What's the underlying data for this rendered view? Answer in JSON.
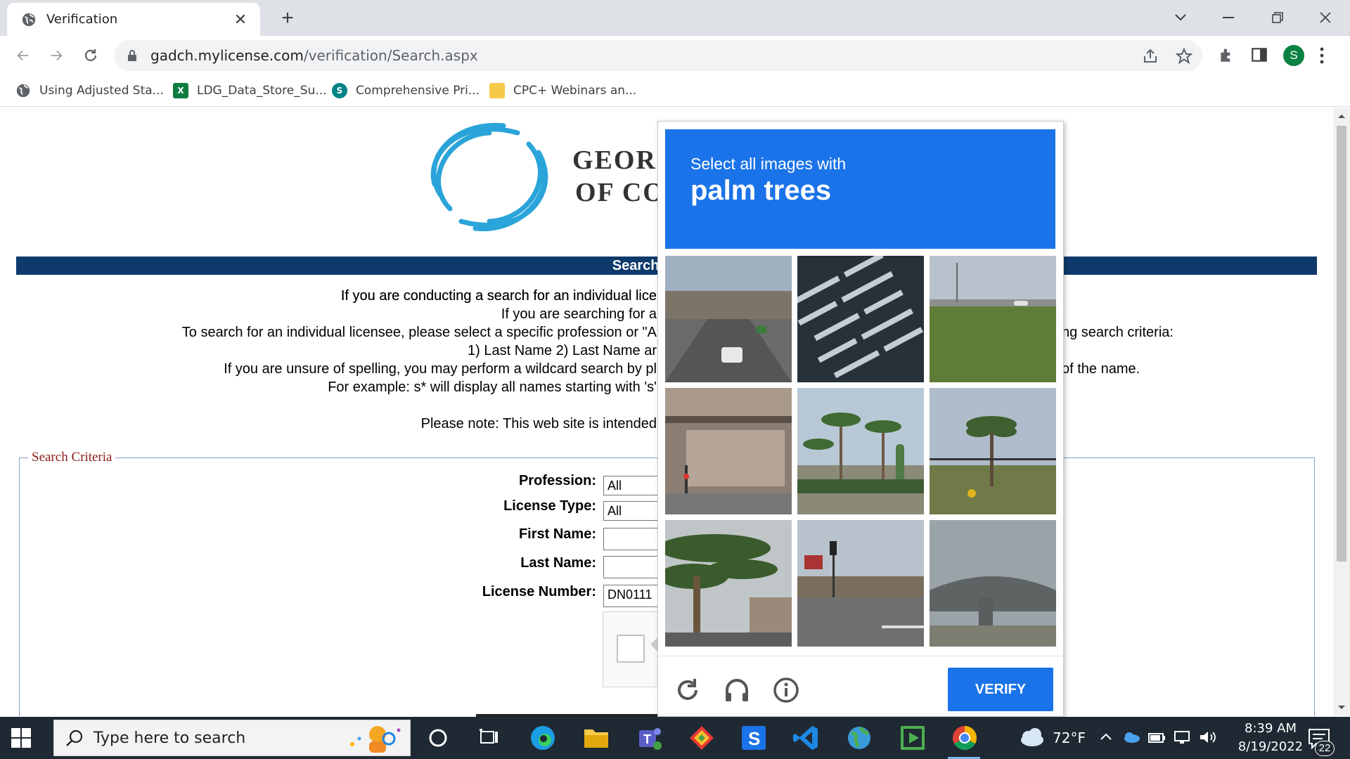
{
  "browser": {
    "tab_title": "Verification",
    "url_host": "gadch.mylicense.com",
    "url_path": "/verification/Search.aspx",
    "profile_initial": "S",
    "bookmarks": [
      {
        "label": "Using Adjusted Sta..."
      },
      {
        "label": "LDG_Data_Store_Su..."
      },
      {
        "label": "Comprehensive Pri..."
      },
      {
        "label": "CPC+ Webinars an..."
      }
    ]
  },
  "page": {
    "logo_line1": "GEOR",
    "logo_line2": "OF CO",
    "banner": "Search for a Pro",
    "info_lines": [
      "If you are conducting a search for an individual lice",
      "If you are searching for a",
      "To search for an individual licensee, please select a specific profession or \"A",
      "1) Last Name 2) Last Name ar",
      "If you are unsure of spelling, you may perform a wildcard search by pl",
      "For example: s* will display all names starting with 's'",
      "Please note: This web site is intended"
    ],
    "info_right_1": "ng search criteria:",
    "info_right_2": "of the name.",
    "fieldset_legend": "Search Criteria",
    "form": {
      "profession_label": "Profession:",
      "profession_value": "All",
      "license_type_label": "License Type:",
      "license_type_value": "All",
      "first_name_label": "First Name:",
      "first_name_value": "",
      "last_name_label": "Last Name:",
      "last_name_value": "",
      "license_number_label": "License Number:",
      "license_number_value": "DN0111"
    }
  },
  "captcha": {
    "instruction": "Select all images with",
    "target": "palm trees",
    "verify_label": "VERIFY",
    "tiles": [
      {
        "name": "highway-overpass-tile"
      },
      {
        "name": "aerial-lot-tile"
      },
      {
        "name": "grass-field-tile"
      },
      {
        "name": "station-building-tile"
      },
      {
        "name": "palm-cactus-tile"
      },
      {
        "name": "palm-road-tile"
      },
      {
        "name": "palm-closeup-tile"
      },
      {
        "name": "street-intersection-tile"
      },
      {
        "name": "bridge-underside-tile"
      }
    ]
  },
  "taskbar": {
    "search_placeholder": "Type here to search",
    "weather": "72°F",
    "time": "8:39 AM",
    "date": "8/19/2022",
    "notification_count": "22"
  }
}
